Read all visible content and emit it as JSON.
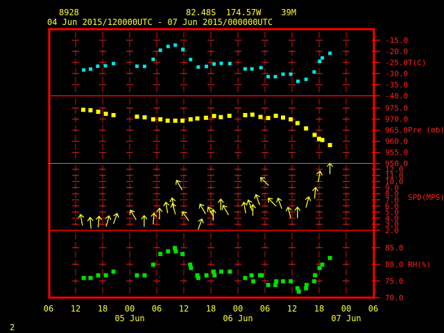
{
  "header": {
    "station_id": "8928",
    "location": "82.48S  174.57W    39M",
    "time_range": "04 Jun 2015/120000UTC - 07 Jun 2015/000000UTC"
  },
  "page_number": "2",
  "colors": {
    "frame": "#ff0000",
    "text": "#ffff33",
    "temp": "#00e5e5",
    "pressure": "#ffff00",
    "wind": "#ffff33",
    "rh": "#00e000"
  },
  "chart_data": {
    "type": "scatter",
    "x_units": "hours since 04 Jun 06UTC",
    "xlim": [
      0,
      72
    ],
    "x_tick_labels": [
      "06",
      "12",
      "18",
      "00",
      "06",
      "12",
      "18",
      "00",
      "06",
      "12",
      "18",
      "00",
      "06"
    ],
    "date_labels": [
      {
        "label": "05 Jun",
        "hour": 18
      },
      {
        "label": "06 Jun",
        "hour": 42
      },
      {
        "label": "07 Jun",
        "hour": 66
      }
    ],
    "panels": {
      "temperature": {
        "label": "T(C)",
        "ylim": [
          -40,
          -15
        ],
        "tick_labels": [
          "-15.0",
          "-20.0",
          "-25.0",
          "-30.0",
          "-35.0",
          "-40.0"
        ],
        "x": [
          7.8,
          9.3,
          10.9,
          12.6,
          14.4,
          19.6,
          21.3,
          23.2,
          24.8,
          26.5,
          28.1,
          29.8,
          31.5,
          33.2,
          35.0,
          36.7,
          38.3,
          40.2,
          43.6,
          45.1,
          47.1,
          48.7,
          50.3,
          52.0,
          53.7,
          55.3,
          57.1,
          58.9,
          60.1,
          60.7,
          62.4
        ],
        "values": [
          -28.4,
          -28.0,
          -26.7,
          -26.5,
          -25.5,
          -26.7,
          -26.8,
          -23.6,
          -19.5,
          -17.8,
          -17.2,
          -19.1,
          -23.7,
          -27.1,
          -26.8,
          -25.7,
          -25.4,
          -25.5,
          -27.9,
          -27.9,
          -27.4,
          -31.4,
          -31.4,
          -30.3,
          -30.3,
          -33.5,
          -32.6,
          -29.3,
          -24.5,
          -23.0,
          -20.9
        ]
      },
      "pressure": {
        "label": "Pre (mb)",
        "ylim": [
          950,
          975
        ],
        "tick_labels": [
          "975.0",
          "970.0",
          "965.0",
          "960.0",
          "955.0",
          "950.0"
        ],
        "x": [
          7.7,
          9.3,
          11.0,
          12.7,
          14.4,
          19.6,
          21.3,
          23.2,
          24.8,
          26.4,
          28.1,
          29.7,
          31.5,
          33.0,
          34.9,
          36.7,
          38.2,
          40.1,
          43.6,
          45.2,
          47.0,
          48.7,
          50.4,
          52.0,
          53.7,
          55.2,
          57.1,
          59.0,
          60.0,
          60.7,
          62.4
        ],
        "values": [
          974.2,
          974.0,
          973.3,
          972.4,
          971.8,
          971.1,
          970.8,
          969.9,
          969.9,
          969.3,
          969.3,
          969.3,
          969.9,
          970.3,
          970.6,
          971.4,
          970.9,
          971.5,
          971.8,
          972.0,
          971.0,
          970.5,
          971.5,
          970.7,
          969.9,
          968.2,
          965.8,
          962.9,
          961.1,
          960.6,
          958.3
        ]
      },
      "wind": {
        "label": "SPD(MPS)",
        "ylim": [
          2,
          12
        ],
        "tick_labels": [
          "12.0",
          "11.0",
          "10.0",
          "9.0",
          "8.0",
          "7.0",
          "6.0",
          "5.0",
          "4.0",
          "3.0",
          "2.0"
        ],
        "x": [
          7.3,
          9.3,
          11.1,
          13.1,
          14.8,
          18.8,
          21.2,
          23.3,
          24.6,
          26.2,
          27.6,
          27.8,
          29.0,
          30.4,
          33.6,
          34.2,
          36.0,
          36.5,
          38.2,
          39.3,
          43.5,
          44.7,
          45.3,
          46.4,
          47.9,
          49.6,
          51.3,
          53.4,
          55.2,
          57.4,
          59.1,
          60.0,
          62.4
        ],
        "speed": [
          3.7,
          3.2,
          3.4,
          3.5,
          3.9,
          4.5,
          3.5,
          3.9,
          4.7,
          5.7,
          6.4,
          5.5,
          9.4,
          4.3,
          3.0,
          5.5,
          5.0,
          4.5,
          6.2,
          5.3,
          5.7,
          6.1,
          5.3,
          7.0,
          10.0,
          6.6,
          6.4,
          4.9,
          4.9,
          6.6,
          8.1,
          10.8,
          12.1
        ],
        "arrow_angle_deg": [
          -10,
          -5,
          5,
          15,
          20,
          -30,
          0,
          5,
          0,
          -10,
          -10,
          -15,
          -30,
          -35,
          20,
          -30,
          -30,
          0,
          0,
          -30,
          -10,
          -20,
          0,
          -20,
          -45,
          -45,
          -20,
          -15,
          0,
          15,
          5,
          10,
          0
        ]
      },
      "humidity": {
        "label": "RH(%)",
        "ylim": [
          70,
          85
        ],
        "tick_labels": [
          "85.0",
          "80.0",
          "75.0",
          "70.0"
        ],
        "x": [
          7.8,
          9.3,
          11.0,
          12.7,
          14.4,
          19.6,
          21.3,
          23.2,
          24.8,
          26.5,
          28.0,
          28.2,
          29.7,
          31.4,
          31.6,
          33.0,
          33.2,
          35.0,
          36.6,
          36.8,
          38.3,
          40.2,
          43.6,
          45.0,
          45.4,
          46.9,
          47.3,
          48.7,
          50.3,
          50.5,
          52.0,
          53.7,
          55.2,
          55.5,
          57.1,
          57.2,
          58.9,
          59.1,
          60.1,
          60.7,
          62.4
        ],
        "values": [
          75.9,
          75.9,
          76.7,
          76.7,
          77.8,
          76.7,
          76.7,
          79.9,
          83.1,
          83.9,
          84.9,
          83.9,
          83.1,
          79.9,
          78.9,
          76.7,
          75.9,
          76.7,
          77.8,
          76.7,
          77.8,
          77.8,
          75.9,
          76.7,
          74.9,
          76.7,
          76.7,
          73.8,
          73.8,
          74.9,
          74.9,
          74.9,
          72.8,
          71.8,
          72.8,
          73.8,
          74.9,
          76.7,
          78.9,
          79.9,
          81.9
        ]
      }
    }
  }
}
